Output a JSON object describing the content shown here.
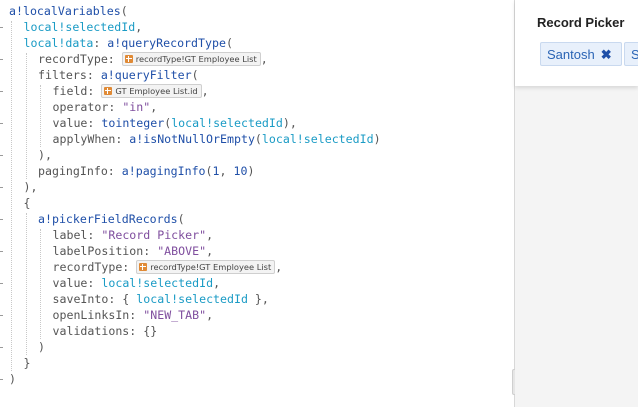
{
  "code_lines": [
    {
      "indent": 0,
      "parts": [
        {
          "c": "fn",
          "t": "a!localVariables"
        },
        {
          "c": "plain",
          "t": "("
        }
      ]
    },
    {
      "indent": 1,
      "parts": [
        {
          "c": "var",
          "t": "local!selectedId"
        },
        {
          "c": "plain",
          "t": ","
        }
      ]
    },
    {
      "indent": 1,
      "parts": [
        {
          "c": "var",
          "t": "local!data"
        },
        {
          "c": "plain",
          "t": ": "
        },
        {
          "c": "fn",
          "t": "a!queryRecordType"
        },
        {
          "c": "plain",
          "t": "("
        }
      ]
    },
    {
      "indent": 2,
      "parts": [
        {
          "c": "plain",
          "t": "recordType: "
        },
        {
          "c": "chip",
          "t": "recordType!GT Employee List"
        },
        {
          "c": "plain",
          "t": ","
        }
      ]
    },
    {
      "indent": 2,
      "parts": [
        {
          "c": "plain",
          "t": "filters: "
        },
        {
          "c": "fn",
          "t": "a!queryFilter"
        },
        {
          "c": "plain",
          "t": "("
        }
      ]
    },
    {
      "indent": 3,
      "parts": [
        {
          "c": "plain",
          "t": "field: "
        },
        {
          "c": "chip",
          "t": "GT Employee List.id"
        },
        {
          "c": "plain",
          "t": ","
        }
      ]
    },
    {
      "indent": 3,
      "parts": [
        {
          "c": "plain",
          "t": "operator: "
        },
        {
          "c": "str",
          "t": "\"in\""
        },
        {
          "c": "plain",
          "t": ","
        }
      ]
    },
    {
      "indent": 3,
      "parts": [
        {
          "c": "plain",
          "t": "value: "
        },
        {
          "c": "fn",
          "t": "tointeger"
        },
        {
          "c": "plain",
          "t": "("
        },
        {
          "c": "var",
          "t": "local!selectedId"
        },
        {
          "c": "plain",
          "t": "),"
        }
      ]
    },
    {
      "indent": 3,
      "parts": [
        {
          "c": "plain",
          "t": "applyWhen: "
        },
        {
          "c": "fn",
          "t": "a!isNotNullOrEmpty"
        },
        {
          "c": "plain",
          "t": "("
        },
        {
          "c": "var",
          "t": "local!selectedId"
        },
        {
          "c": "plain",
          "t": ")"
        }
      ]
    },
    {
      "indent": 2,
      "parts": [
        {
          "c": "plain",
          "t": "),"
        }
      ]
    },
    {
      "indent": 2,
      "parts": [
        {
          "c": "plain",
          "t": "pagingInfo: "
        },
        {
          "c": "fn",
          "t": "a!pagingInfo"
        },
        {
          "c": "plain",
          "t": "("
        },
        {
          "c": "num",
          "t": "1"
        },
        {
          "c": "plain",
          "t": ", "
        },
        {
          "c": "num",
          "t": "10"
        },
        {
          "c": "plain",
          "t": ")"
        }
      ]
    },
    {
      "indent": 1,
      "parts": [
        {
          "c": "plain",
          "t": "),"
        }
      ]
    },
    {
      "indent": 1,
      "parts": [
        {
          "c": "plain",
          "t": "{"
        }
      ]
    },
    {
      "indent": 2,
      "parts": [
        {
          "c": "fn",
          "t": "a!pickerFieldRecords"
        },
        {
          "c": "plain",
          "t": "("
        }
      ]
    },
    {
      "indent": 3,
      "parts": [
        {
          "c": "plain",
          "t": "label: "
        },
        {
          "c": "str",
          "t": "\"Record Picker\""
        },
        {
          "c": "plain",
          "t": ","
        }
      ]
    },
    {
      "indent": 3,
      "parts": [
        {
          "c": "plain",
          "t": "labelPosition: "
        },
        {
          "c": "str",
          "t": "\"ABOVE\""
        },
        {
          "c": "plain",
          "t": ","
        }
      ]
    },
    {
      "indent": 3,
      "parts": [
        {
          "c": "plain",
          "t": "recordType: "
        },
        {
          "c": "chip",
          "t": "recordType!GT Employee List"
        },
        {
          "c": "plain",
          "t": ","
        }
      ]
    },
    {
      "indent": 3,
      "parts": [
        {
          "c": "plain",
          "t": "value: "
        },
        {
          "c": "var",
          "t": "local!selectedId"
        },
        {
          "c": "plain",
          "t": ","
        }
      ]
    },
    {
      "indent": 3,
      "parts": [
        {
          "c": "plain",
          "t": "saveInto: { "
        },
        {
          "c": "var",
          "t": "local!selectedId"
        },
        {
          "c": "plain",
          "t": " },"
        }
      ]
    },
    {
      "indent": 3,
      "parts": [
        {
          "c": "plain",
          "t": "openLinksIn: "
        },
        {
          "c": "str",
          "t": "\"NEW_TAB\""
        },
        {
          "c": "plain",
          "t": ","
        }
      ]
    },
    {
      "indent": 3,
      "parts": [
        {
          "c": "plain",
          "t": "validations: {}"
        }
      ]
    },
    {
      "indent": 2,
      "parts": [
        {
          "c": "plain",
          "t": ")"
        }
      ]
    },
    {
      "indent": 1,
      "parts": [
        {
          "c": "plain",
          "t": "}"
        }
      ]
    },
    {
      "indent": 0,
      "parts": [
        {
          "c": "plain",
          "t": ")"
        }
      ]
    }
  ],
  "colors": {
    "function": "#1f4fa8",
    "variable": "#1a9bc5",
    "string": "#7f4e9e",
    "plain": "#555555",
    "record_icon": "#e08a36"
  },
  "preview": {
    "label": "Record Picker",
    "tokens": [
      {
        "text": "Santosh",
        "remove_icon": "close-icon"
      },
      {
        "text": "S",
        "remove_icon": ""
      }
    ]
  },
  "splitter": {
    "collapse_icon": "chevron-left-icon",
    "collapse_glyph": "❮"
  }
}
